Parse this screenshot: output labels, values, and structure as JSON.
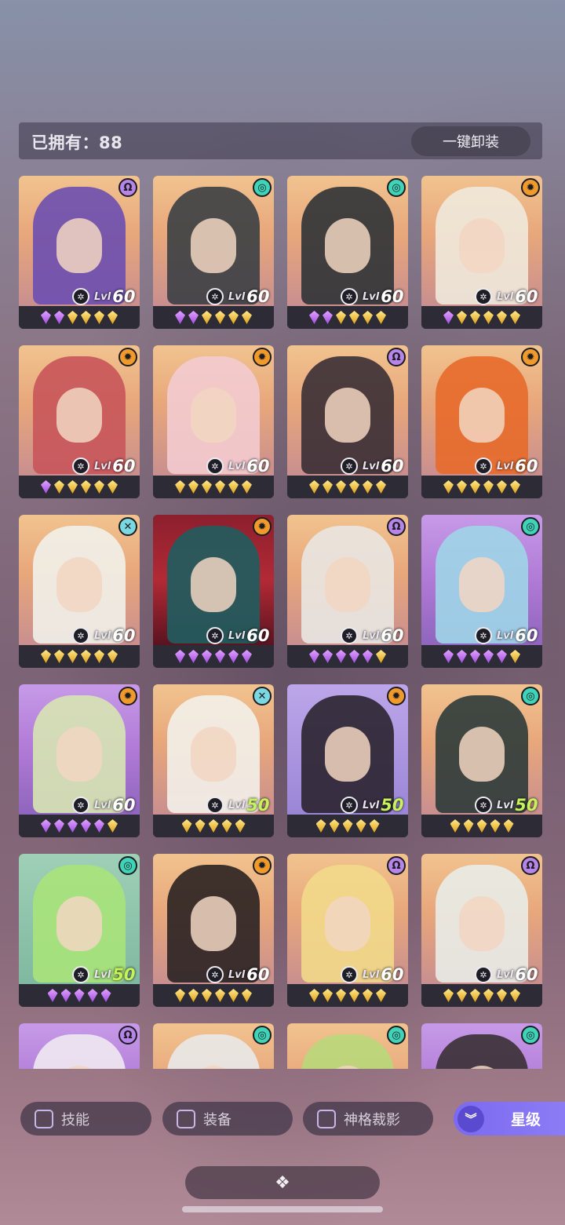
{
  "header": {
    "owned_label": "已拥有：88",
    "unequip_all_label": "一键卸装"
  },
  "colors": {
    "accent": "#8b7cf2",
    "element_dark": "#b784e8",
    "element_wind": "#3fd4b8",
    "element_fire": "#f09a2c",
    "element_water": "#7ad8e0"
  },
  "level_prefix": "Lvl",
  "heroes": [
    {
      "bg": "orange",
      "element": "dark",
      "level": "60",
      "gems": [
        "p",
        "p",
        "y",
        "y",
        "y",
        "y"
      ]
    },
    {
      "bg": "orange",
      "element": "wind",
      "level": "60",
      "gems": [
        "p",
        "p",
        "y",
        "y",
        "y",
        "y"
      ]
    },
    {
      "bg": "orange",
      "element": "wind",
      "level": "60",
      "gems": [
        "p",
        "p",
        "y",
        "y",
        "y",
        "y"
      ]
    },
    {
      "bg": "orange",
      "element": "fire",
      "level": "60",
      "gems": [
        "p",
        "y",
        "y",
        "y",
        "y",
        "y"
      ]
    },
    {
      "bg": "orange",
      "element": "fire",
      "level": "60",
      "gems": [
        "p",
        "y",
        "y",
        "y",
        "y",
        "y"
      ]
    },
    {
      "bg": "orange",
      "element": "fire",
      "level": "60",
      "gems": [
        "y",
        "y",
        "y",
        "y",
        "y",
        "y"
      ]
    },
    {
      "bg": "orange",
      "element": "dark",
      "level": "60",
      "gems": [
        "y",
        "y",
        "y",
        "y",
        "y",
        "y"
      ]
    },
    {
      "bg": "orange",
      "element": "fire",
      "level": "60",
      "gems": [
        "y",
        "y",
        "y",
        "y",
        "y",
        "y"
      ]
    },
    {
      "bg": "orange",
      "element": "water",
      "level": "60",
      "gems": [
        "y",
        "y",
        "y",
        "y",
        "y",
        "y"
      ]
    },
    {
      "bg": "crimson",
      "element": "fire",
      "level": "60",
      "gems": [
        "p",
        "p",
        "p",
        "p",
        "p",
        "p"
      ]
    },
    {
      "bg": "orange",
      "element": "dark",
      "level": "60",
      "gems": [
        "p",
        "p",
        "p",
        "p",
        "p",
        "y"
      ]
    },
    {
      "bg": "purple",
      "element": "wind",
      "level": "60",
      "gems": [
        "p",
        "p",
        "p",
        "p",
        "p",
        "y"
      ]
    },
    {
      "bg": "purple",
      "element": "fire",
      "level": "60",
      "gems": [
        "p",
        "p",
        "p",
        "p",
        "p",
        "y"
      ]
    },
    {
      "bg": "orange",
      "element": "water",
      "level": "50",
      "gems": [
        "y",
        "y",
        "y",
        "y",
        "y"
      ]
    },
    {
      "bg": "lav",
      "element": "fire",
      "level": "50",
      "gems": [
        "y",
        "y",
        "y",
        "y",
        "y"
      ]
    },
    {
      "bg": "orange",
      "element": "wind",
      "level": "50",
      "gems": [
        "y",
        "y",
        "y",
        "y",
        "y"
      ]
    },
    {
      "bg": "green",
      "element": "wind",
      "level": "50",
      "gems": [
        "p",
        "p",
        "p",
        "p",
        "p"
      ]
    },
    {
      "bg": "orange",
      "element": "fire",
      "level": "60",
      "gems": [
        "y",
        "y",
        "y",
        "y",
        "y",
        "y"
      ]
    },
    {
      "bg": "orange",
      "element": "dark",
      "level": "60",
      "gems": [
        "y",
        "y",
        "y",
        "y",
        "y",
        "y"
      ]
    },
    {
      "bg": "orange",
      "element": "dark",
      "level": "60",
      "gems": [
        "y",
        "y",
        "y",
        "y",
        "y",
        "y"
      ]
    },
    {
      "bg": "purple",
      "element": "dark",
      "level": "",
      "gems": []
    },
    {
      "bg": "orange",
      "element": "wind",
      "level": "",
      "gems": []
    },
    {
      "bg": "orange",
      "element": "wind",
      "level": "",
      "gems": []
    },
    {
      "bg": "purple",
      "element": "wind",
      "level": "",
      "gems": []
    }
  ],
  "filters": {
    "skill_label": "技能",
    "equipment_label": "装备",
    "divine_shadow_label": "神格裁影",
    "star_label": "星级"
  },
  "bottom": {
    "icon": "diamond-cluster-icon"
  }
}
